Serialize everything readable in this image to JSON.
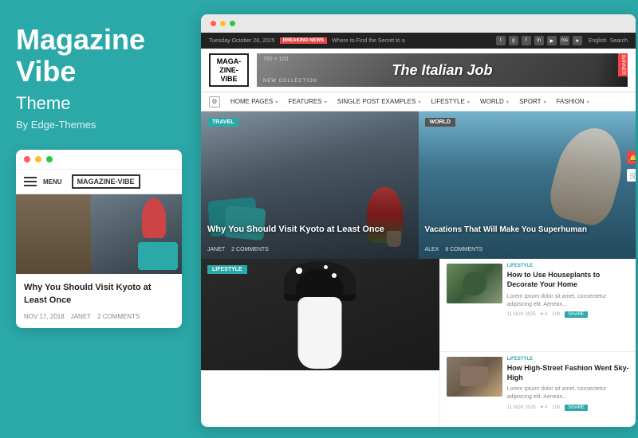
{
  "brand": {
    "title": "Magazine Vibe",
    "subtitle": "Theme",
    "by": "By Edge-Themes"
  },
  "mobile_preview": {
    "nav_menu": "MENU",
    "nav_logo": "MAGAZINE-VIBE",
    "article_title": "Why You Should Visit Kyoto at Least Once",
    "meta_date": "NOV 17, 2018",
    "meta_author": "JANET",
    "meta_comments": "2 COMMENTS"
  },
  "browser": {
    "top_bar_date": "Tuesday October 28, 2025",
    "breaking_label": "BREAKING NEWS",
    "breaking_text": "Where to Find the Secret to a",
    "lang": "English",
    "search_placeholder": "Search"
  },
  "site_logo": {
    "line1": "MAGA-",
    "line2": "ZINE-",
    "line3": "VIBE"
  },
  "banner": {
    "size": "760 × 100",
    "title": "The Italian Job",
    "subtitle": "NEW COLLECTION",
    "label": "BANNER"
  },
  "navigation": {
    "items": [
      {
        "label": "HOME PAGES",
        "has_dropdown": true
      },
      {
        "label": "FEATURES",
        "has_dropdown": true
      },
      {
        "label": "SINGLE POST EXAMPLES",
        "has_dropdown": true
      },
      {
        "label": "LIFESTYLE",
        "has_dropdown": true
      },
      {
        "label": "WORLD",
        "has_dropdown": true
      },
      {
        "label": "SPORT",
        "has_dropdown": true
      },
      {
        "label": "FASHION",
        "has_dropdown": true
      }
    ]
  },
  "hero": {
    "left": {
      "tag": "TRAVEL",
      "title": "Why You Should Visit Kyoto at Least Once",
      "meta_author": "JANET",
      "meta_comments": "2 COMMENTS"
    },
    "right": {
      "tag": "WORLD",
      "title": "Vacations That Will Make You Superhuman",
      "meta_author": "ALEX",
      "meta_comments": "8 COMMENTS"
    }
  },
  "content": {
    "main_tag": "LIFESTYLE",
    "sidebar": {
      "article1": {
        "tag": "LIFESTYLE",
        "title": "How to Use Houseplants to Decorate Your Home",
        "excerpt": "Lorem ipsum dolor sit amet, consectetur adipiscing elit. Aenean...",
        "date": "11 NOV 2025",
        "likes": "4",
        "comments": "100",
        "share": "SHARE"
      },
      "article2": {
        "tag": "LIFESTYLE",
        "title": "How High-Street Fashion Went Sky-High",
        "excerpt": "Lorem ipsum dolor sit amet, consectetur adipiscing elit. Aenean...",
        "date": "11 NOV 2025",
        "likes": "4",
        "comments": "100",
        "share": "SHARE"
      }
    }
  },
  "icons": {
    "settings": "⚙",
    "calendar": "📅",
    "user": "👤",
    "comment": "💬",
    "heart": "♥",
    "cart": "🛒",
    "chevron": "▾"
  }
}
